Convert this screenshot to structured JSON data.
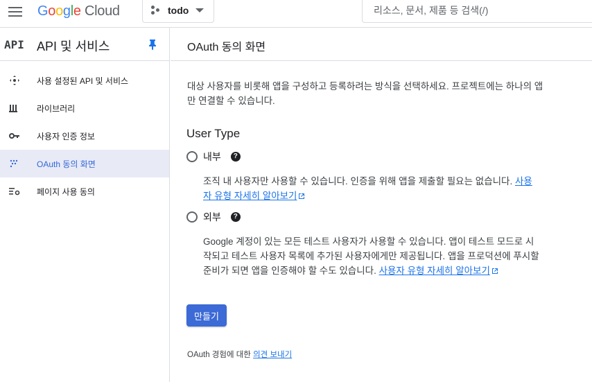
{
  "header": {
    "logo_google": [
      "G",
      "o",
      "o",
      "g",
      "l",
      "e"
    ],
    "logo_cloud": "Cloud",
    "project_name": "todo",
    "search_placeholder": "리소스, 문서, 제품 등 검색(/)"
  },
  "sidebar": {
    "badge": "API",
    "title": "API 및 서비스",
    "items": [
      {
        "label": "사용 설정된 API 및 서비스",
        "icon": "api-services-icon"
      },
      {
        "label": "라이브러리",
        "icon": "library-icon"
      },
      {
        "label": "사용자 인증 정보",
        "icon": "key-icon"
      },
      {
        "label": "OAuth 동의 화면",
        "icon": "oauth-consent-icon",
        "active": true
      },
      {
        "label": "페이지 사용 동의",
        "icon": "page-usage-icon"
      }
    ]
  },
  "main": {
    "title": "OAuth 동의 화면",
    "intro": "대상 사용자를 비롯해 앱을 구성하고 등록하려는 방식을 선택하세요. 프로젝트에는 하나의 앱만 연결할 수 있습니다.",
    "section_title": "User Type",
    "internal": {
      "label": "내부",
      "desc": "조직 내 사용자만 사용할 수 있습니다. 인증을 위해 앱을 제출할 필요는 없습니다. ",
      "link": "사용자 유형 자세히 알아보기"
    },
    "external": {
      "label": "외부",
      "desc": "Google 계정이 있는 모든 테스트 사용자가 사용할 수 있습니다. 앱이 테스트 모드로 시작되고 테스트 사용자 목록에 추가된 사용자에게만 제공됩니다. 앱을 프로덕션에 푸시할 준비가 되면 앱을 인증해야 할 수도 있습니다. ",
      "link": "사용자 유형 자세히 알아보기"
    },
    "create_button": "만들기",
    "feedback_prefix": "OAuth 경험에 대한 ",
    "feedback_link": "의견 보내기"
  },
  "colors": {
    "accent": "#1a73e8",
    "active_bg": "#e8eaf6",
    "button": "#3c6ad6"
  }
}
